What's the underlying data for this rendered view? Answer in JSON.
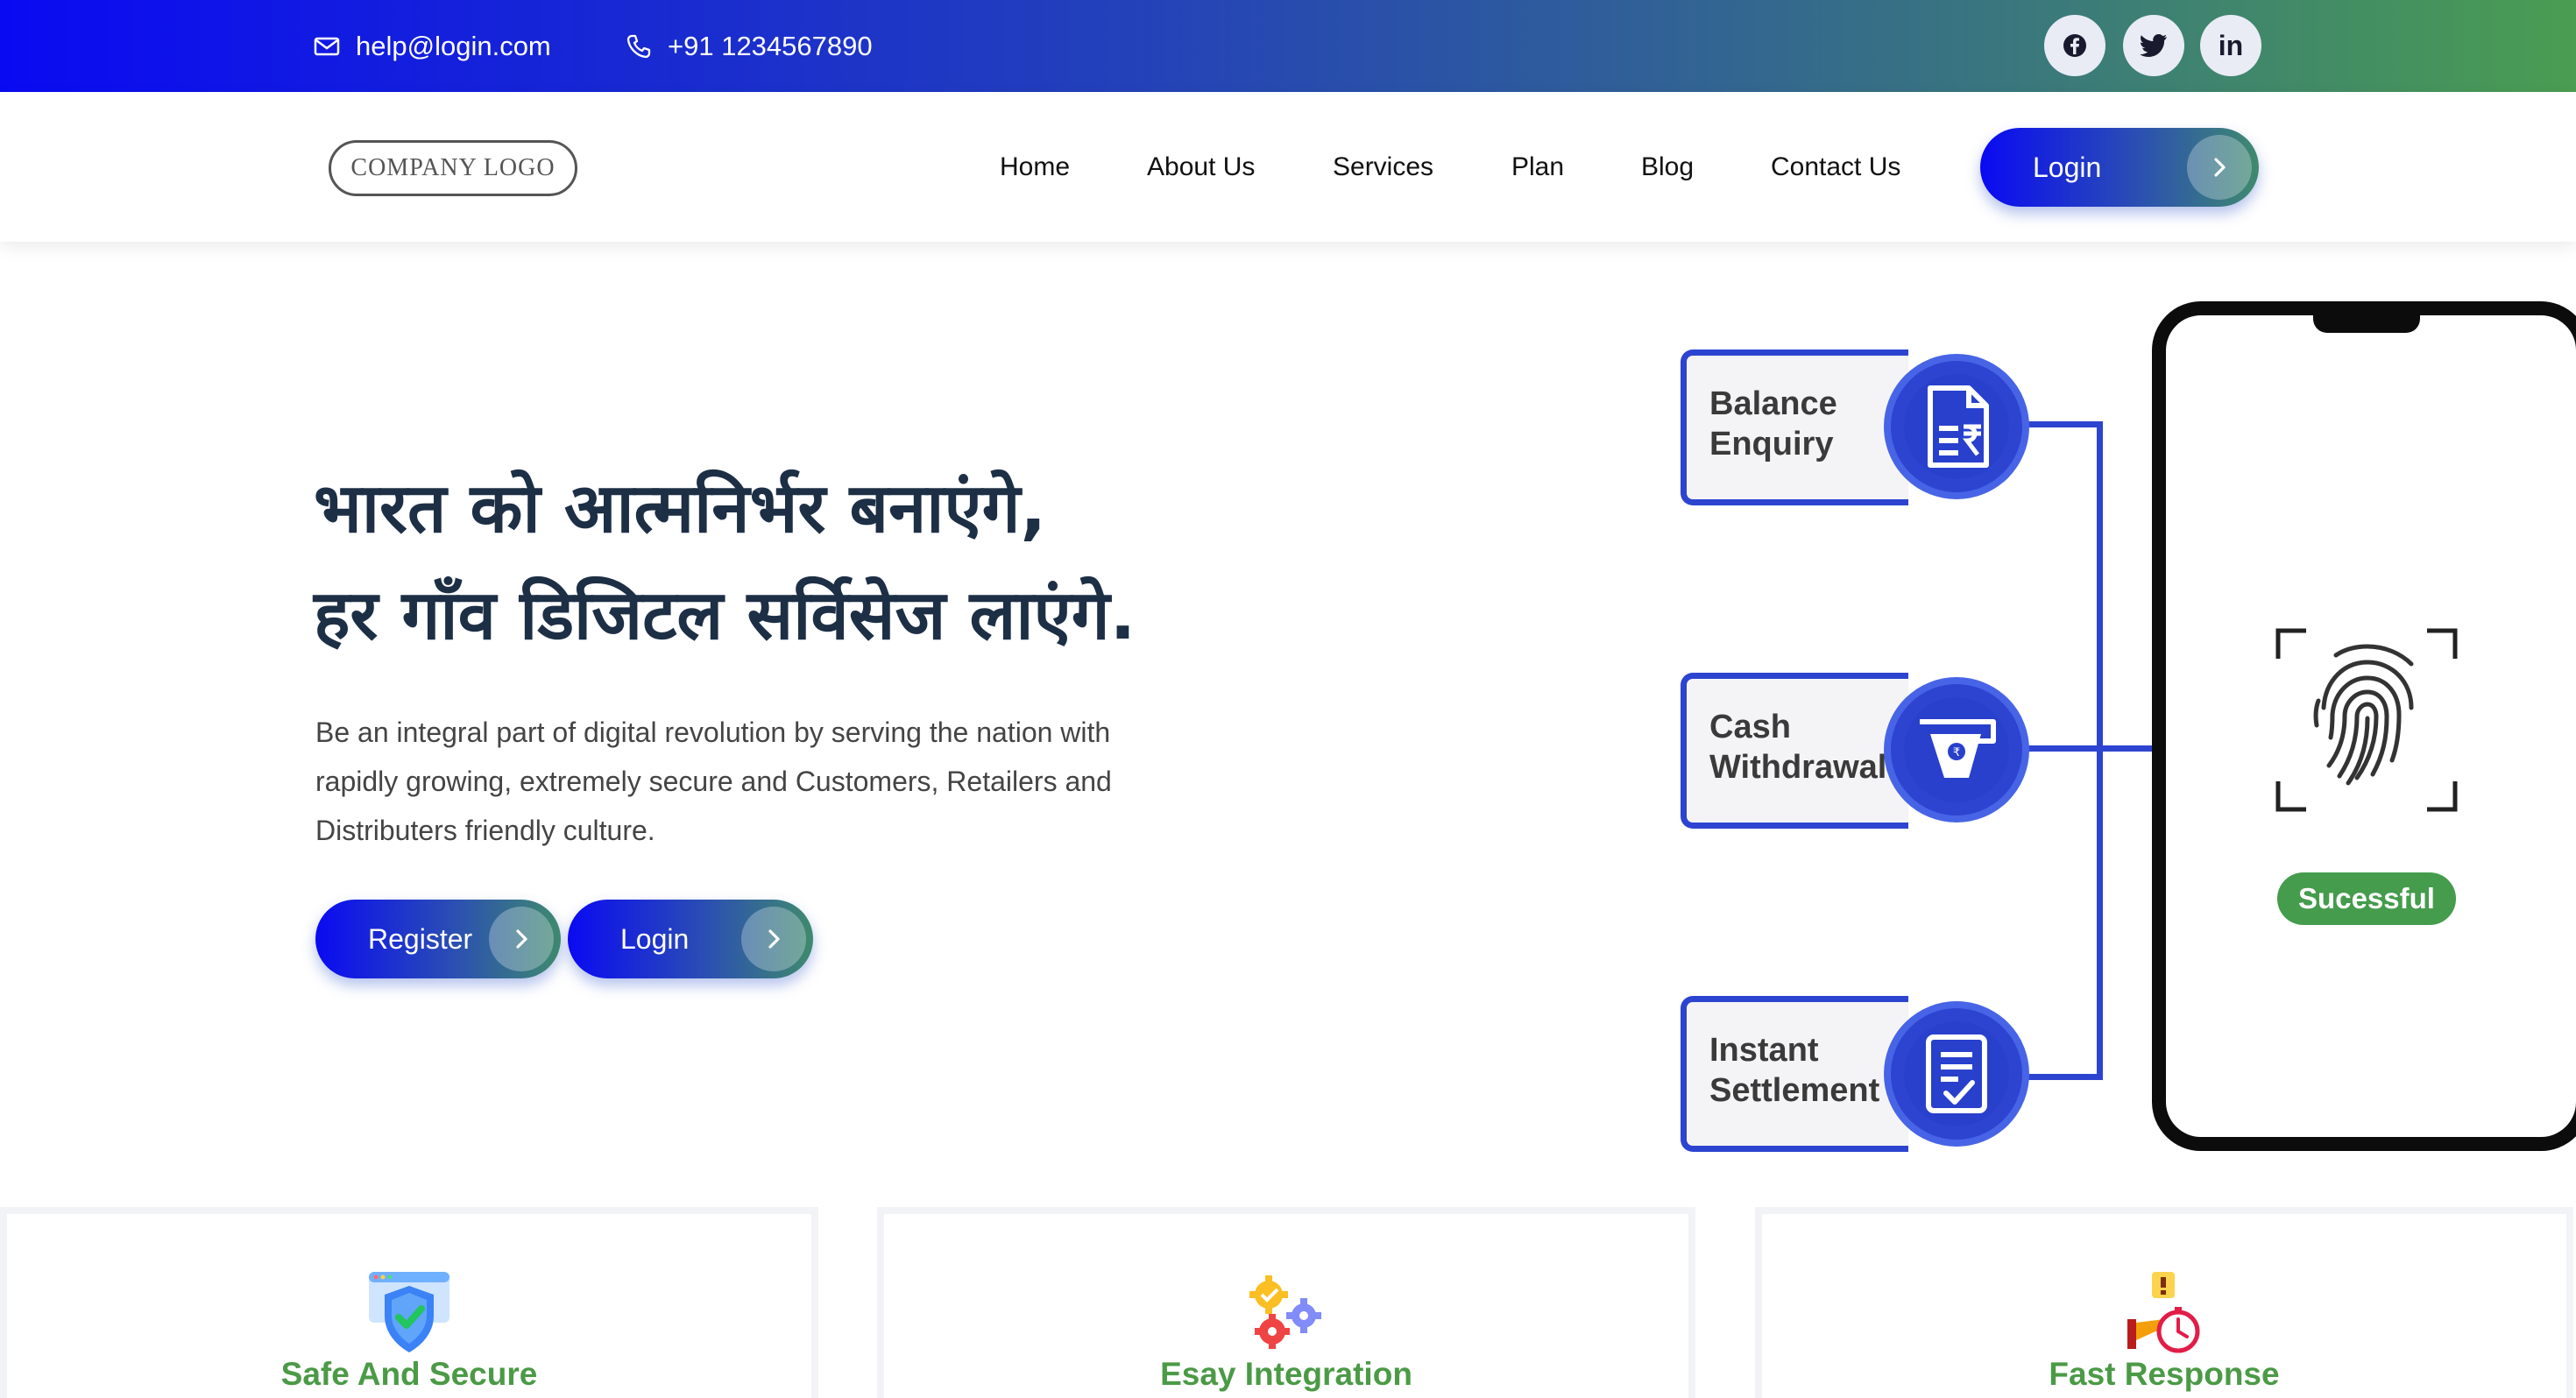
{
  "topbar": {
    "email": "help@login.com",
    "phone": "+91 1234567890",
    "social": [
      {
        "icon": "facebook-icon"
      },
      {
        "icon": "twitter-icon"
      },
      {
        "icon": "linkedin-icon",
        "glyph": "in"
      }
    ]
  },
  "nav": {
    "logo": "COMPANY LOGO",
    "links": [
      "Home",
      "About Us",
      "Services",
      "Plan",
      "Blog",
      "Contact Us"
    ],
    "login": "Login"
  },
  "hero": {
    "title_line1": "भारत को आत्मनिर्भर बनाएंगे,",
    "title_line2": "हर गाँव डिजिटल सर्विसेज लाएंगे.",
    "description": "Be an integral part of digital revolution by serving the nation with rapidly growing, extremely secure and Customers, Retailers and Distributers friendly culture.",
    "register": "Register",
    "login": "Login"
  },
  "illustration": {
    "cards": [
      {
        "line1": "Balance",
        "line2": "Enquiry",
        "icon": "document-rupee-icon"
      },
      {
        "line1": "Cash",
        "line2": "Withdrawal",
        "icon": "atm-card-icon"
      },
      {
        "line1": "Instant",
        "line2": "Settlement",
        "icon": "checklist-icon"
      }
    ],
    "status": "Sucessful"
  },
  "features": [
    {
      "title": "Safe And Secure",
      "icon": "shield-check-icon"
    },
    {
      "title": "Esay Integration",
      "icon": "gears-icon"
    },
    {
      "title": "Fast Response",
      "icon": "stopwatch-hand-icon"
    }
  ],
  "colors": {
    "brand_blue": "#0a0af2",
    "brand_green": "#4a9d52",
    "accent_blue": "#2d44d1",
    "title_dark": "#1d2f45"
  }
}
